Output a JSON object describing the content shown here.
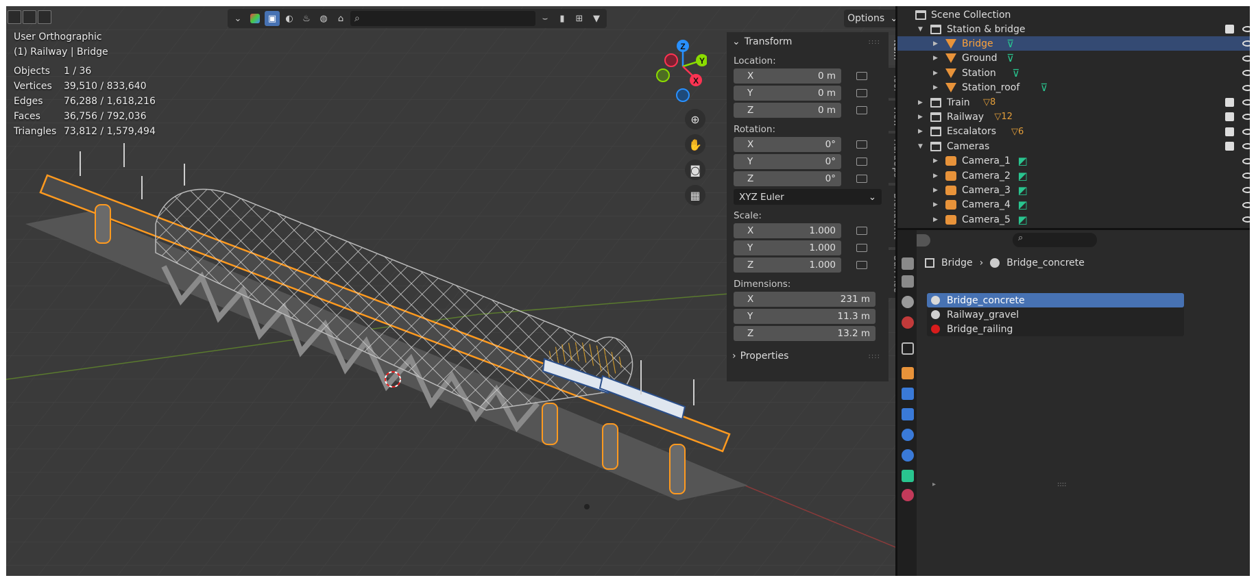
{
  "viewport": {
    "view_name": "User Orthographic",
    "context": "(1) Railway | Bridge",
    "stats": [
      {
        "key": "Objects",
        "value": "1 / 36"
      },
      {
        "key": "Vertices",
        "value": "39,510 / 833,640"
      },
      {
        "key": "Edges",
        "value": "76,288 / 1,618,216"
      },
      {
        "key": "Faces",
        "value": "36,756 / 792,036"
      },
      {
        "key": "Triangles",
        "value": "73,812 / 1,579,494"
      }
    ],
    "options_label": "Options",
    "gizmo": {
      "z": "Z",
      "y": "Y",
      "x": "X"
    }
  },
  "npanel": {
    "transform_label": "Transform",
    "location_label": "Location:",
    "location": [
      {
        "axis": "X",
        "value": "0 m"
      },
      {
        "axis": "Y",
        "value": "0 m"
      },
      {
        "axis": "Z",
        "value": "0 m"
      }
    ],
    "rotation_label": "Rotation:",
    "rotation": [
      {
        "axis": "X",
        "value": "0°"
      },
      {
        "axis": "Y",
        "value": "0°"
      },
      {
        "axis": "Z",
        "value": "0°"
      }
    ],
    "rotation_mode": "XYZ Euler",
    "scale_label": "Scale:",
    "scale": [
      {
        "axis": "X",
        "value": "1.000"
      },
      {
        "axis": "Y",
        "value": "1.000"
      },
      {
        "axis": "Z",
        "value": "1.000"
      }
    ],
    "dimensions_label": "Dimensions:",
    "dimensions": [
      {
        "axis": "X",
        "value": "231 m"
      },
      {
        "axis": "Y",
        "value": "11.3 m"
      },
      {
        "axis": "Z",
        "value": "13.2 m"
      }
    ],
    "properties_label": "Properties",
    "tabs": [
      "Item",
      "Tool",
      "View",
      "HardOps",
      "BlenderKit",
      "Surf Ace"
    ]
  },
  "outliner": {
    "scene_collection": "Scene Collection",
    "rows": [
      {
        "label": "Station & bridge",
        "kind": "collection",
        "depth": 1,
        "expanded": true
      },
      {
        "label": "Bridge",
        "kind": "mesh",
        "depth": 2,
        "selected": true
      },
      {
        "label": "Ground",
        "kind": "mesh",
        "depth": 2
      },
      {
        "label": "Station",
        "kind": "mesh",
        "depth": 2
      },
      {
        "label": "Station_roof",
        "kind": "mesh",
        "depth": 2
      },
      {
        "label": "Train",
        "kind": "collection",
        "depth": 1,
        "count": "8"
      },
      {
        "label": "Railway",
        "kind": "collection",
        "depth": 1,
        "count": "12"
      },
      {
        "label": "Escalators",
        "kind": "collection",
        "depth": 1,
        "count": "6"
      },
      {
        "label": "Cameras",
        "kind": "collection",
        "depth": 1,
        "expanded": true
      },
      {
        "label": "Camera_1",
        "kind": "camera",
        "depth": 2
      },
      {
        "label": "Camera_2",
        "kind": "camera",
        "depth": 2
      },
      {
        "label": "Camera_3",
        "kind": "camera",
        "depth": 2
      },
      {
        "label": "Camera_4",
        "kind": "camera",
        "depth": 2
      },
      {
        "label": "Camera_5",
        "kind": "camera",
        "depth": 2
      }
    ]
  },
  "properties": {
    "breadcrumb_object": "Bridge",
    "breadcrumb_material": "Bridge_concrete",
    "materials": [
      {
        "name": "Bridge_concrete",
        "color": "#d8d8d8",
        "selected": true
      },
      {
        "name": "Railway_gravel",
        "color": "#cfcfcf"
      },
      {
        "name": "Bridge_railing",
        "color": "#d81c1c"
      }
    ]
  },
  "colors": {
    "accent": "#4772b3",
    "selected_text": "#ffa33a",
    "outline": "#ff9a1f",
    "x_axis": "#ff3352",
    "y_axis": "#8bdc00",
    "z_axis": "#2890ff"
  }
}
